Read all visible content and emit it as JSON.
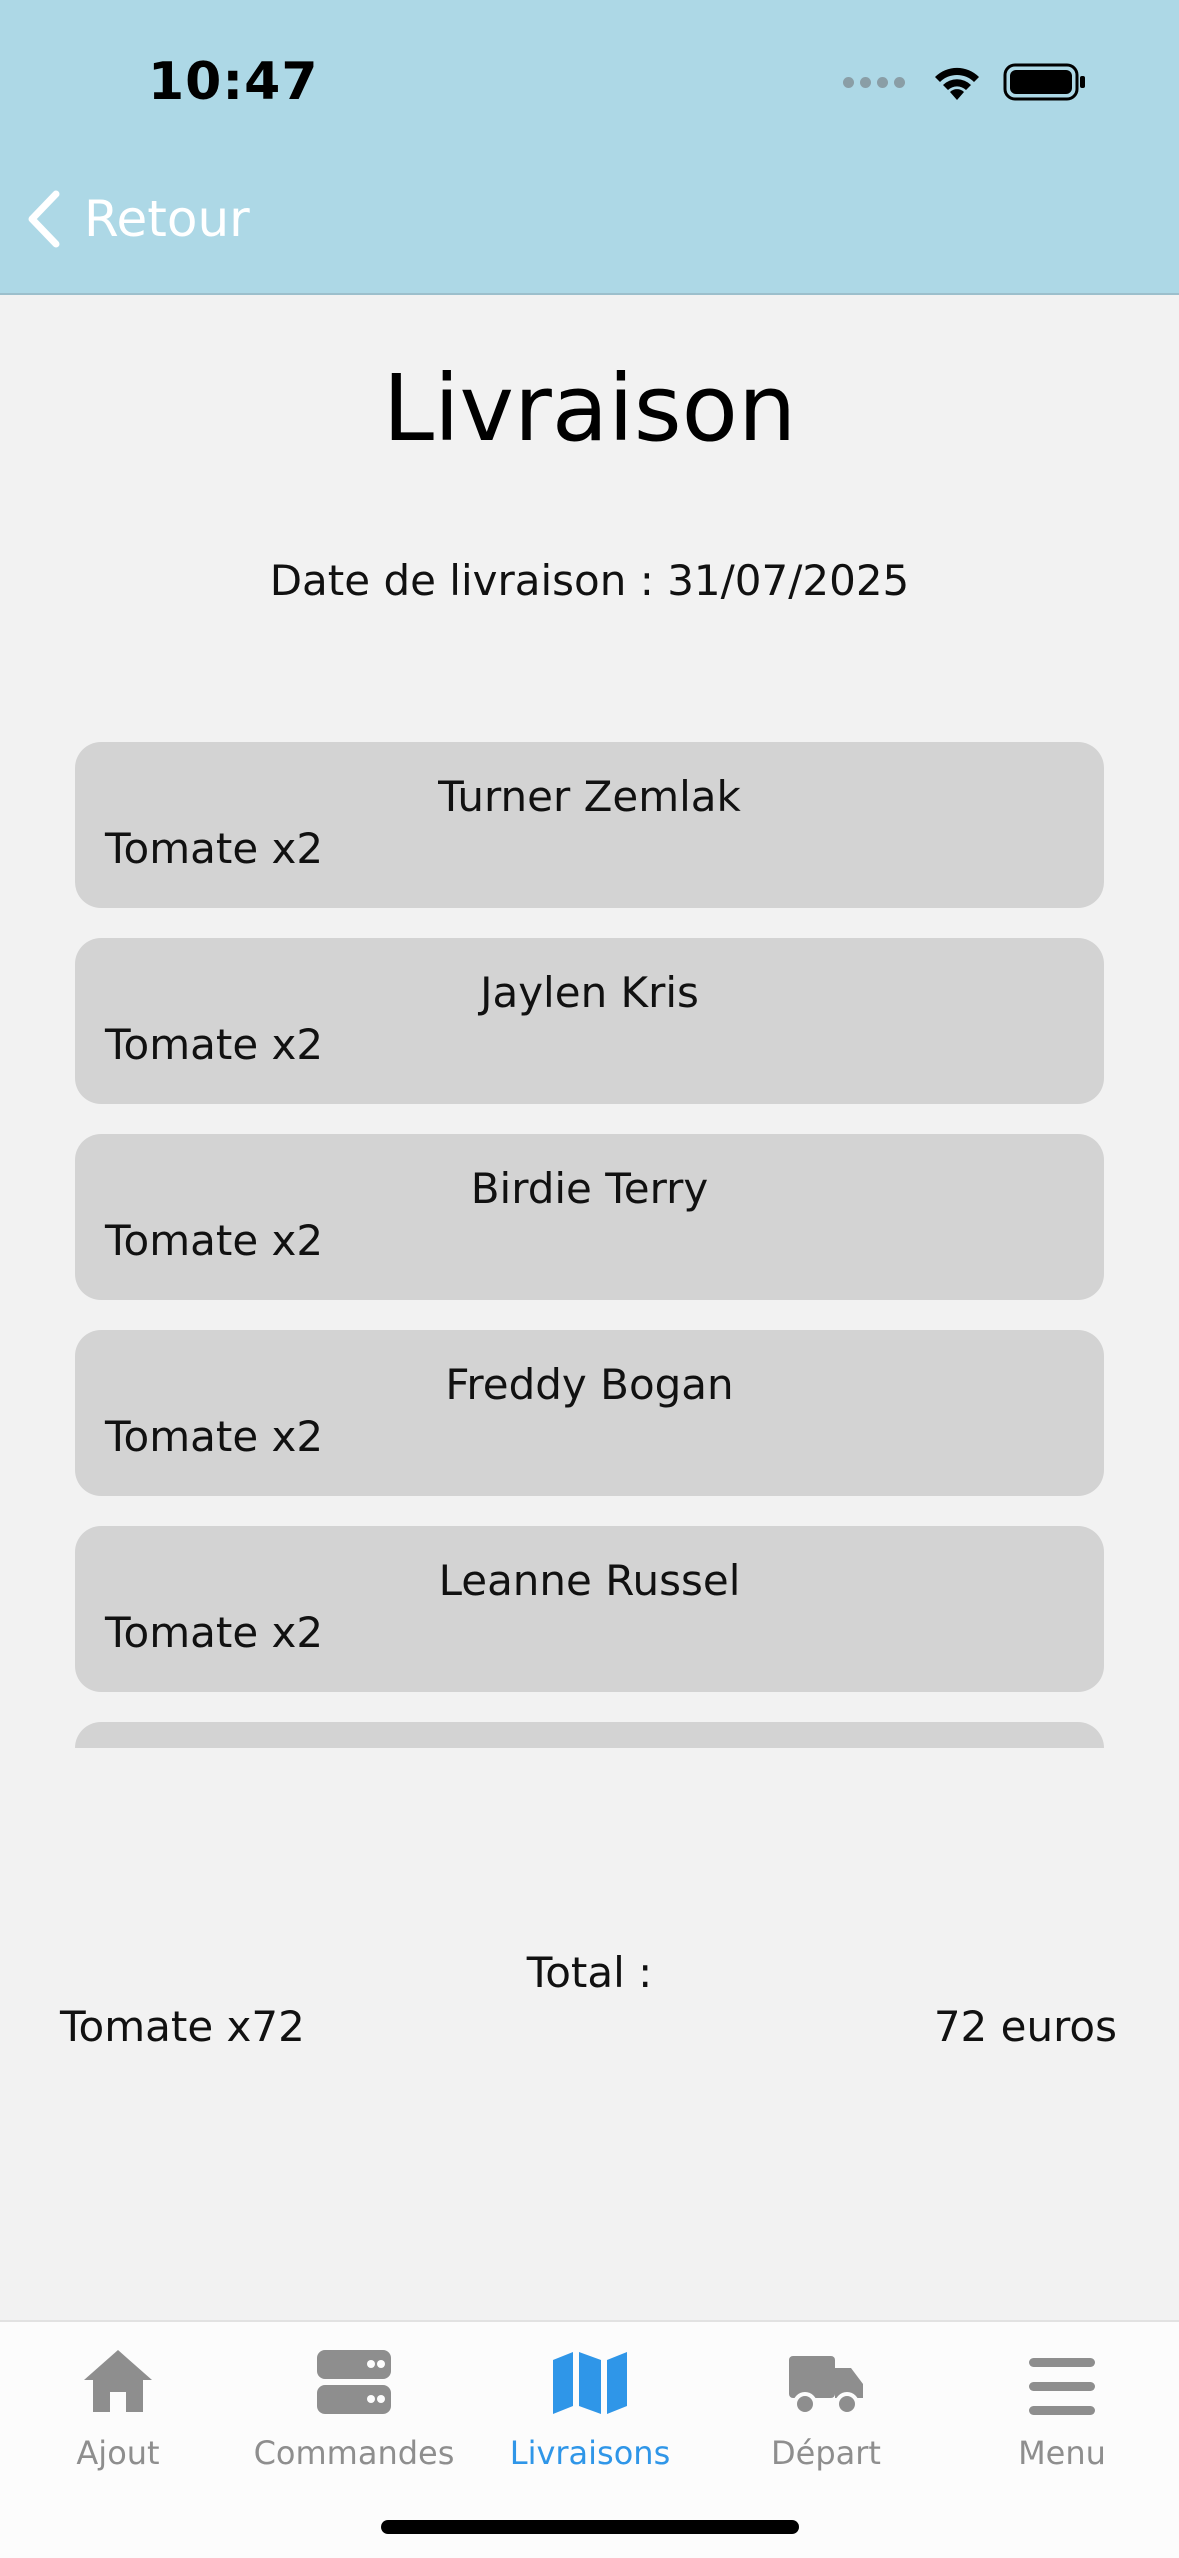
{
  "status_bar": {
    "time": "10:47"
  },
  "header": {
    "back_label": "Retour"
  },
  "page": {
    "title": "Livraison",
    "date_line": "Date de livraison : 31/07/2025"
  },
  "deliveries": [
    {
      "name": "Turner Zemlak",
      "item": "Tomate x2"
    },
    {
      "name": "Jaylen Kris",
      "item": "Tomate x2"
    },
    {
      "name": "Birdie Terry",
      "item": "Tomate x2"
    },
    {
      "name": "Freddy Bogan",
      "item": "Tomate x2"
    },
    {
      "name": "Leanne Russel",
      "item": "Tomate x2"
    },
    {
      "name": "",
      "item": ""
    }
  ],
  "total": {
    "label": "Total :",
    "item": "Tomate x72",
    "price": "72 euros"
  },
  "tabbar": {
    "active_color": "#2f96e8",
    "inactive_color": "#8e8e8e",
    "tabs": [
      {
        "label": "Ajout",
        "icon": "home-icon"
      },
      {
        "label": "Commandes",
        "icon": "server-icon"
      },
      {
        "label": "Livraisons",
        "icon": "map-icon",
        "active": true
      },
      {
        "label": "Départ",
        "icon": "truck-icon"
      },
      {
        "label": "Menu",
        "icon": "menu-icon"
      }
    ]
  }
}
